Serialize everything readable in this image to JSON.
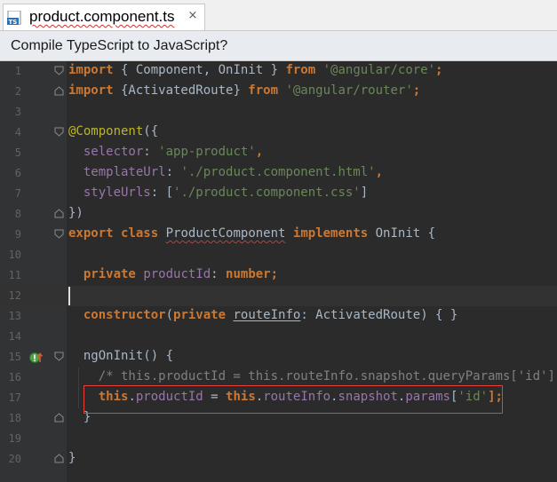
{
  "tab": {
    "filename": "product.component.ts",
    "file_type_icon": "typescript-file-icon",
    "close_glyph": "×"
  },
  "banner": {
    "message": "Compile TypeScript to JavaScript?"
  },
  "editor": {
    "current_line": 12,
    "lines": [
      {
        "n": "1",
        "tokens": [
          {
            "t": "import",
            "c": "kw"
          },
          {
            "t": " { Component, OnInit } ",
            "c": ""
          },
          {
            "t": "from",
            "c": "kw"
          },
          {
            "t": " ",
            "c": ""
          },
          {
            "t": "'@angular/core'",
            "c": "str"
          },
          {
            "t": ";",
            "c": "kw"
          }
        ]
      },
      {
        "n": "2",
        "tokens": [
          {
            "t": "import",
            "c": "kw"
          },
          {
            "t": " {ActivatedRoute} ",
            "c": ""
          },
          {
            "t": "from",
            "c": "kw"
          },
          {
            "t": " ",
            "c": ""
          },
          {
            "t": "'@angular/router'",
            "c": "str"
          },
          {
            "t": ";",
            "c": "kw"
          }
        ]
      },
      {
        "n": "3",
        "tokens": []
      },
      {
        "n": "4",
        "tokens": [
          {
            "t": "@Component",
            "c": "ann"
          },
          {
            "t": "({",
            "c": ""
          }
        ]
      },
      {
        "n": "5",
        "tokens": [
          {
            "t": "  selector",
            "c": "fld"
          },
          {
            "t": ": ",
            "c": ""
          },
          {
            "t": "'app-product'",
            "c": "str"
          },
          {
            "t": ",",
            "c": "kw"
          }
        ]
      },
      {
        "n": "6",
        "tokens": [
          {
            "t": "  templateUrl",
            "c": "fld"
          },
          {
            "t": ": ",
            "c": ""
          },
          {
            "t": "'./product.component.html'",
            "c": "str"
          },
          {
            "t": ",",
            "c": "kw"
          }
        ]
      },
      {
        "n": "7",
        "tokens": [
          {
            "t": "  styleUrls",
            "c": "fld"
          },
          {
            "t": ": [",
            "c": ""
          },
          {
            "t": "'./product.component.css'",
            "c": "str"
          },
          {
            "t": "]",
            "c": ""
          }
        ]
      },
      {
        "n": "8",
        "tokens": [
          {
            "t": "})",
            "c": ""
          }
        ]
      },
      {
        "n": "9",
        "tokens": [
          {
            "t": "export",
            "c": "kw"
          },
          {
            "t": " ",
            "c": ""
          },
          {
            "t": "class",
            "c": "kw"
          },
          {
            "t": " ",
            "c": ""
          },
          {
            "t": "ProductComponent",
            "c": "cls sq"
          },
          {
            "t": " ",
            "c": ""
          },
          {
            "t": "implements",
            "c": "kw"
          },
          {
            "t": " OnInit {",
            "c": ""
          }
        ]
      },
      {
        "n": "10",
        "tokens": []
      },
      {
        "n": "11",
        "tokens": [
          {
            "t": "  ",
            "c": ""
          },
          {
            "t": "private",
            "c": "kw"
          },
          {
            "t": " ",
            "c": ""
          },
          {
            "t": "productId",
            "c": "fld"
          },
          {
            "t": ": ",
            "c": ""
          },
          {
            "t": "number",
            "c": "kw"
          },
          {
            "t": ";",
            "c": "kw"
          }
        ]
      },
      {
        "n": "12",
        "tokens": []
      },
      {
        "n": "13",
        "tokens": [
          {
            "t": "  ",
            "c": ""
          },
          {
            "t": "constructor",
            "c": "kw"
          },
          {
            "t": "(",
            "c": ""
          },
          {
            "t": "private",
            "c": "kw"
          },
          {
            "t": " ",
            "c": ""
          },
          {
            "t": "routeInfo",
            "c": "ul"
          },
          {
            "t": ": ActivatedRoute) { }",
            "c": ""
          }
        ]
      },
      {
        "n": "14",
        "tokens": []
      },
      {
        "n": "15",
        "tokens": [
          {
            "t": "  ngOnInit() {",
            "c": ""
          }
        ]
      },
      {
        "n": "16",
        "tokens": [
          {
            "t": "    ",
            "c": ""
          },
          {
            "t": "/* this.productId = this.routeInfo.snapshot.queryParams['id'];*/",
            "c": "cmt"
          }
        ]
      },
      {
        "n": "17",
        "tokens": [
          {
            "t": "    ",
            "c": ""
          },
          {
            "t": "this",
            "c": "kw"
          },
          {
            "t": ".",
            "c": ""
          },
          {
            "t": "productId",
            "c": "fld"
          },
          {
            "t": " = ",
            "c": ""
          },
          {
            "t": "this",
            "c": "kw"
          },
          {
            "t": ".",
            "c": ""
          },
          {
            "t": "routeInfo",
            "c": "fld"
          },
          {
            "t": ".",
            "c": ""
          },
          {
            "t": "snapshot",
            "c": "fld"
          },
          {
            "t": ".",
            "c": ""
          },
          {
            "t": "params",
            "c": "fld"
          },
          {
            "t": "[",
            "c": ""
          },
          {
            "t": "'id'",
            "c": "str"
          },
          {
            "t": "];",
            "c": "kw"
          }
        ]
      },
      {
        "n": "18",
        "tokens": [
          {
            "t": "  }",
            "c": ""
          }
        ]
      },
      {
        "n": "19",
        "tokens": []
      },
      {
        "n": "20",
        "tokens": [
          {
            "t": "}",
            "c": ""
          }
        ]
      }
    ]
  },
  "markers": {
    "implements_icon": "implements-method-icon",
    "highlight_color": "#e8403a"
  },
  "colors": {
    "editor_bg": "#2b2b2b",
    "gutter_bg": "#313335",
    "keyword": "#cc7832",
    "string": "#6a8759",
    "annotation": "#bbb529",
    "field": "#9876aa",
    "comment": "#808080"
  }
}
